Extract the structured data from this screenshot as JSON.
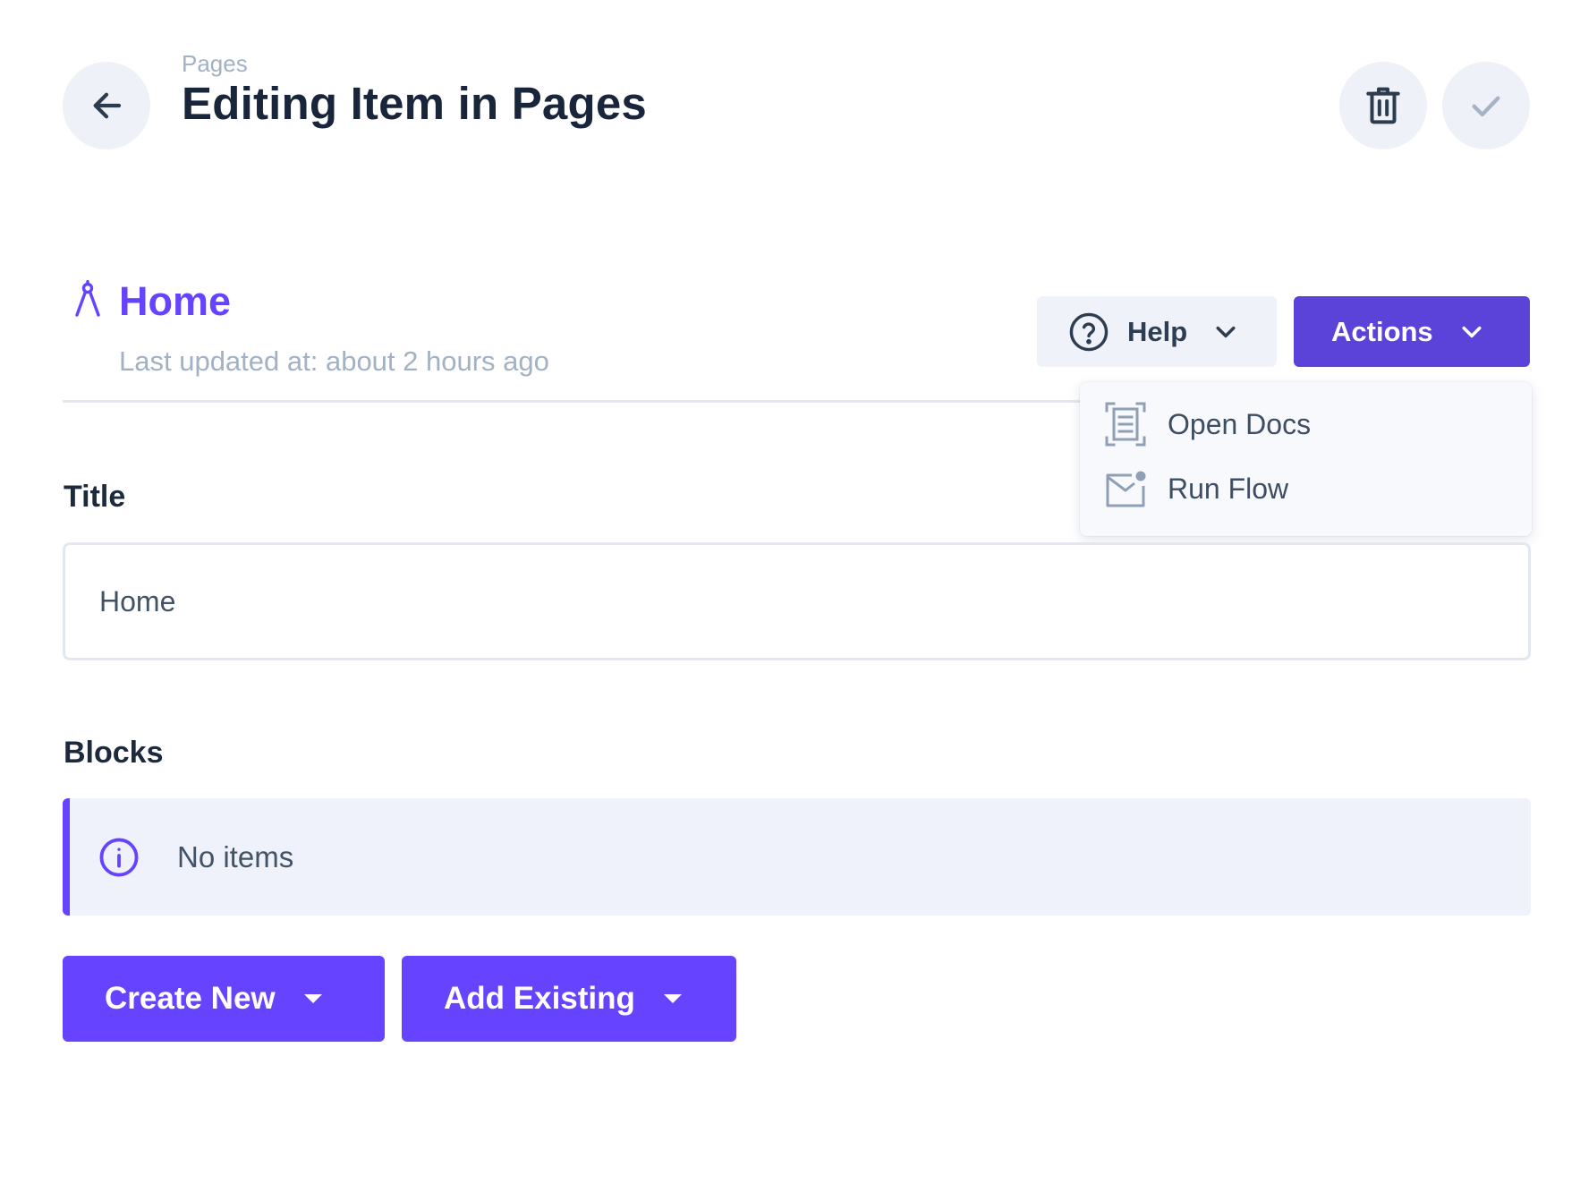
{
  "header": {
    "breadcrumb": "Pages",
    "title": "Editing Item in Pages",
    "back_icon": "arrow-left-icon",
    "delete_icon": "trash-icon",
    "save_icon": "check-icon"
  },
  "item": {
    "title": "Home",
    "updated": "Last updated at: about 2 hours ago",
    "icon": "compass-icon"
  },
  "toolbar": {
    "help_label": "Help",
    "actions_label": "Actions"
  },
  "actions_menu": {
    "items": [
      {
        "label": "Open Docs",
        "icon": "document-scan-icon"
      },
      {
        "label": "Run Flow",
        "icon": "mail-notification-icon"
      }
    ]
  },
  "form": {
    "title_label": "Title",
    "title_value": "Home",
    "blocks_label": "Blocks",
    "blocks_empty": "No items",
    "create_new_label": "Create New",
    "add_existing_label": "Add Existing"
  },
  "colors": {
    "accent": "#6644ff",
    "actions_bg": "#5b42d8",
    "muted_text": "#a2b1c4",
    "heading": "#18253a",
    "soft_bg": "#eff2f8"
  }
}
